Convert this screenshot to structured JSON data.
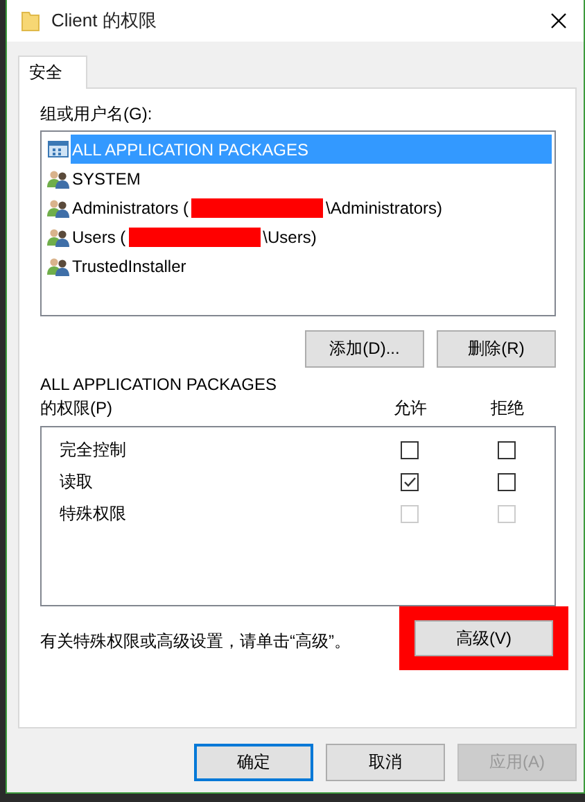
{
  "window": {
    "title": "Client 的权限"
  },
  "tabs": [
    {
      "label": "安全",
      "selected": true
    }
  ],
  "groups": {
    "label": "组或用户名(G):",
    "items": [
      {
        "kind": "package",
        "name": "ALL APPLICATION PACKAGES",
        "selected": true
      },
      {
        "kind": "user",
        "name": "SYSTEM",
        "selected": false
      },
      {
        "kind": "user",
        "name": "Administrators (",
        "redacted": true,
        "suffix": "\\Administrators)",
        "selected": false
      },
      {
        "kind": "user",
        "name": "Users (",
        "redacted": true,
        "suffix": "\\Users)",
        "selected": false
      },
      {
        "kind": "user",
        "name": "TrustedInstaller",
        "selected": false
      }
    ]
  },
  "group_buttons": [
    "添加(D)...",
    "删除(R)"
  ],
  "permissions": {
    "label_line_1": "ALL APPLICATION PACKAGES",
    "label_line_2": "的权限(P)",
    "allow_header": "允许",
    "deny_header": "拒绝",
    "rows": [
      {
        "name": "完全控制",
        "allow": false,
        "deny": false,
        "disabled": false
      },
      {
        "name": "读取",
        "allow": true,
        "deny": false,
        "disabled": false
      },
      {
        "name": "特殊权限",
        "allow": false,
        "deny": false,
        "disabled": true
      }
    ]
  },
  "advanced": {
    "note": "有关特殊权限或高级设置，请单击“高级”。",
    "button": "高级(V)",
    "highlighted": true
  },
  "buttons": [
    {
      "label": "确定",
      "default": true,
      "disabled": false
    },
    {
      "label": "取消",
      "default": false,
      "disabled": false
    },
    {
      "label": "应用(A)",
      "default": false,
      "disabled": true
    }
  ]
}
